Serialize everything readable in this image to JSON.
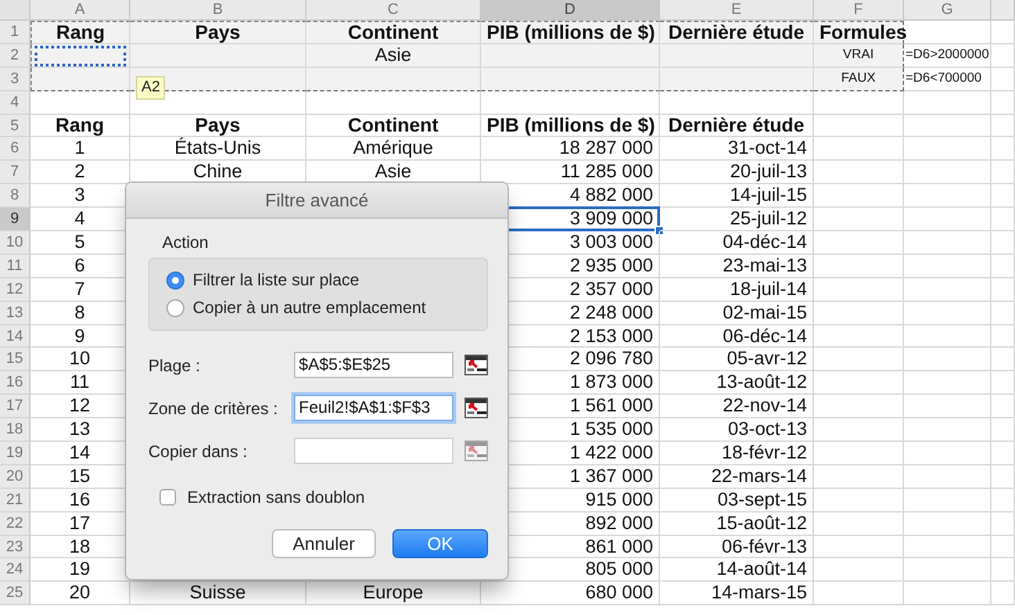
{
  "columns": [
    {
      "label": "A",
      "selected": false
    },
    {
      "label": "B",
      "selected": false
    },
    {
      "label": "C",
      "selected": false
    },
    {
      "label": "D",
      "selected": true
    },
    {
      "label": "E",
      "selected": false
    },
    {
      "label": "F",
      "selected": false
    },
    {
      "label": "G",
      "selected": false
    }
  ],
  "rows": [
    {
      "number": "1",
      "selected": false,
      "kind": "criteria_header",
      "cells": [
        {
          "text": "Rang"
        },
        {
          "text": "Pays"
        },
        {
          "text": "Continent"
        },
        {
          "text": "PIB (millions de $)"
        },
        {
          "text": "Dernière étude"
        },
        {
          "text": "Formules"
        },
        null
      ]
    },
    {
      "number": "2",
      "selected": false,
      "kind": "criteria",
      "cells": [
        {
          "outlined": true
        },
        null,
        {
          "text": "Asie"
        },
        null,
        null,
        {
          "text": "VRAI",
          "small": true
        },
        {
          "text": "=D6>2000000",
          "small": true
        }
      ]
    },
    {
      "number": "3",
      "selected": false,
      "kind": "criteria",
      "cells": [
        null,
        null,
        null,
        null,
        null,
        {
          "text": "FAUX",
          "small": true
        },
        {
          "text": "=D6<700000",
          "small": true
        }
      ]
    },
    {
      "number": "4",
      "selected": false,
      "kind": "blank",
      "cells": [
        null,
        null,
        null,
        null,
        null,
        null,
        null
      ]
    },
    {
      "number": "5",
      "selected": false,
      "kind": "header",
      "cells": [
        {
          "text": "Rang"
        },
        {
          "text": "Pays"
        },
        {
          "text": "Continent"
        },
        {
          "text": "PIB (millions de $)"
        },
        {
          "text": "Dernière étude"
        },
        null,
        null
      ]
    },
    {
      "number": "6",
      "selected": false,
      "kind": "data",
      "cells": [
        {
          "text": "1"
        },
        {
          "text": "États-Unis"
        },
        {
          "text": "Amérique"
        },
        {
          "text": "18 287 000"
        },
        {
          "text": "31-oct-14"
        },
        null,
        null
      ]
    },
    {
      "number": "7",
      "selected": false,
      "kind": "data",
      "cells": [
        {
          "text": "2"
        },
        {
          "text": "Chine"
        },
        {
          "text": "Asie"
        },
        {
          "text": "11 285 000"
        },
        {
          "text": "20-juil-13"
        },
        null,
        null
      ]
    },
    {
      "number": "8",
      "selected": false,
      "kind": "data",
      "cells": [
        {
          "text": "3"
        },
        null,
        null,
        {
          "text": "4 882 000"
        },
        {
          "text": "14-juil-15"
        },
        null,
        null
      ]
    },
    {
      "number": "9",
      "selected": true,
      "kind": "data",
      "cells": [
        {
          "text": "4"
        },
        null,
        null,
        {
          "text": "3 909 000"
        },
        {
          "text": "25-juil-12"
        },
        null,
        null
      ]
    },
    {
      "number": "10",
      "selected": false,
      "kind": "data",
      "cells": [
        {
          "text": "5"
        },
        null,
        null,
        {
          "text": "3 003 000"
        },
        {
          "text": "04-déc-14"
        },
        null,
        null
      ]
    },
    {
      "number": "11",
      "selected": false,
      "kind": "data",
      "cells": [
        {
          "text": "6"
        },
        null,
        null,
        {
          "text": "2 935 000"
        },
        {
          "text": "23-mai-13"
        },
        null,
        null
      ]
    },
    {
      "number": "12",
      "selected": false,
      "kind": "data",
      "cells": [
        {
          "text": "7"
        },
        null,
        null,
        {
          "text": "2 357 000"
        },
        {
          "text": "18-juil-14"
        },
        null,
        null
      ]
    },
    {
      "number": "13",
      "selected": false,
      "kind": "data",
      "cells": [
        {
          "text": "8"
        },
        null,
        null,
        {
          "text": "2 248 000"
        },
        {
          "text": "02-mai-15"
        },
        null,
        null
      ]
    },
    {
      "number": "14",
      "selected": false,
      "kind": "data",
      "cells": [
        {
          "text": "9"
        },
        null,
        null,
        {
          "text": "2 153 000"
        },
        {
          "text": "06-déc-14"
        },
        null,
        null
      ]
    },
    {
      "number": "15",
      "selected": false,
      "kind": "data",
      "cells": [
        {
          "text": "10"
        },
        null,
        null,
        {
          "text": "2 096 780"
        },
        {
          "text": "05-avr-12"
        },
        null,
        null
      ]
    },
    {
      "number": "16",
      "selected": false,
      "kind": "data",
      "cells": [
        {
          "text": "11"
        },
        null,
        null,
        {
          "text": "1 873 000"
        },
        {
          "text": "13-août-12"
        },
        null,
        null
      ]
    },
    {
      "number": "17",
      "selected": false,
      "kind": "data",
      "cells": [
        {
          "text": "12"
        },
        null,
        null,
        {
          "text": "1 561 000"
        },
        {
          "text": "22-nov-14"
        },
        null,
        null
      ]
    },
    {
      "number": "18",
      "selected": false,
      "kind": "data",
      "cells": [
        {
          "text": "13"
        },
        null,
        null,
        {
          "text": "1 535 000"
        },
        {
          "text": "03-oct-13"
        },
        null,
        null
      ]
    },
    {
      "number": "19",
      "selected": false,
      "kind": "data",
      "cells": [
        {
          "text": "14"
        },
        null,
        null,
        {
          "text": "1 422 000"
        },
        {
          "text": "18-févr-12"
        },
        null,
        null
      ]
    },
    {
      "number": "20",
      "selected": false,
      "kind": "data",
      "cells": [
        {
          "text": "15"
        },
        null,
        null,
        {
          "text": "1 367 000"
        },
        {
          "text": "22-mars-14"
        },
        null,
        null
      ]
    },
    {
      "number": "21",
      "selected": false,
      "kind": "data",
      "cells": [
        {
          "text": "16"
        },
        null,
        null,
        {
          "text": "915 000"
        },
        {
          "text": "03-sept-15"
        },
        null,
        null
      ]
    },
    {
      "number": "22",
      "selected": false,
      "kind": "data",
      "cells": [
        {
          "text": "17"
        },
        null,
        null,
        {
          "text": "892 000"
        },
        {
          "text": "15-août-12"
        },
        null,
        null
      ]
    },
    {
      "number": "23",
      "selected": false,
      "kind": "data",
      "cells": [
        {
          "text": "18"
        },
        null,
        null,
        {
          "text": "861 000"
        },
        {
          "text": "06-févr-13"
        },
        null,
        null
      ]
    },
    {
      "number": "24",
      "selected": false,
      "kind": "data",
      "cells": [
        {
          "text": "19"
        },
        null,
        null,
        {
          "text": "805 000"
        },
        {
          "text": "14-août-14"
        },
        null,
        null
      ]
    },
    {
      "number": "25",
      "selected": false,
      "kind": "data",
      "cells": [
        {
          "text": "20"
        },
        {
          "text": "Suisse"
        },
        {
          "text": "Europe"
        },
        {
          "text": "680 000"
        },
        {
          "text": "14-mars-15"
        },
        null,
        null
      ]
    }
  ],
  "tooltip": {
    "text": "A2"
  },
  "dialog": {
    "title": "Filtre avancé",
    "group_label": "Action",
    "options": [
      {
        "label": "Filtrer la liste sur place",
        "selected": true
      },
      {
        "label": "Copier à un autre emplacement",
        "selected": false
      }
    ],
    "fields": [
      {
        "label": "Plage :",
        "value": "$A$5:$E$25",
        "focused": false,
        "disabled": false
      },
      {
        "label": "Zone de critères :",
        "value": "Feuil2!$A$1:$F$3",
        "focused": true,
        "disabled": false
      },
      {
        "label": "Copier dans :",
        "focused": false,
        "disabled": true
      }
    ],
    "checkbox": {
      "label": "Extraction sans doublon",
      "checked": false
    },
    "buttons": [
      {
        "label": "Annuler",
        "kind": "secondary"
      },
      {
        "label": "OK",
        "kind": "primary"
      }
    ]
  }
}
